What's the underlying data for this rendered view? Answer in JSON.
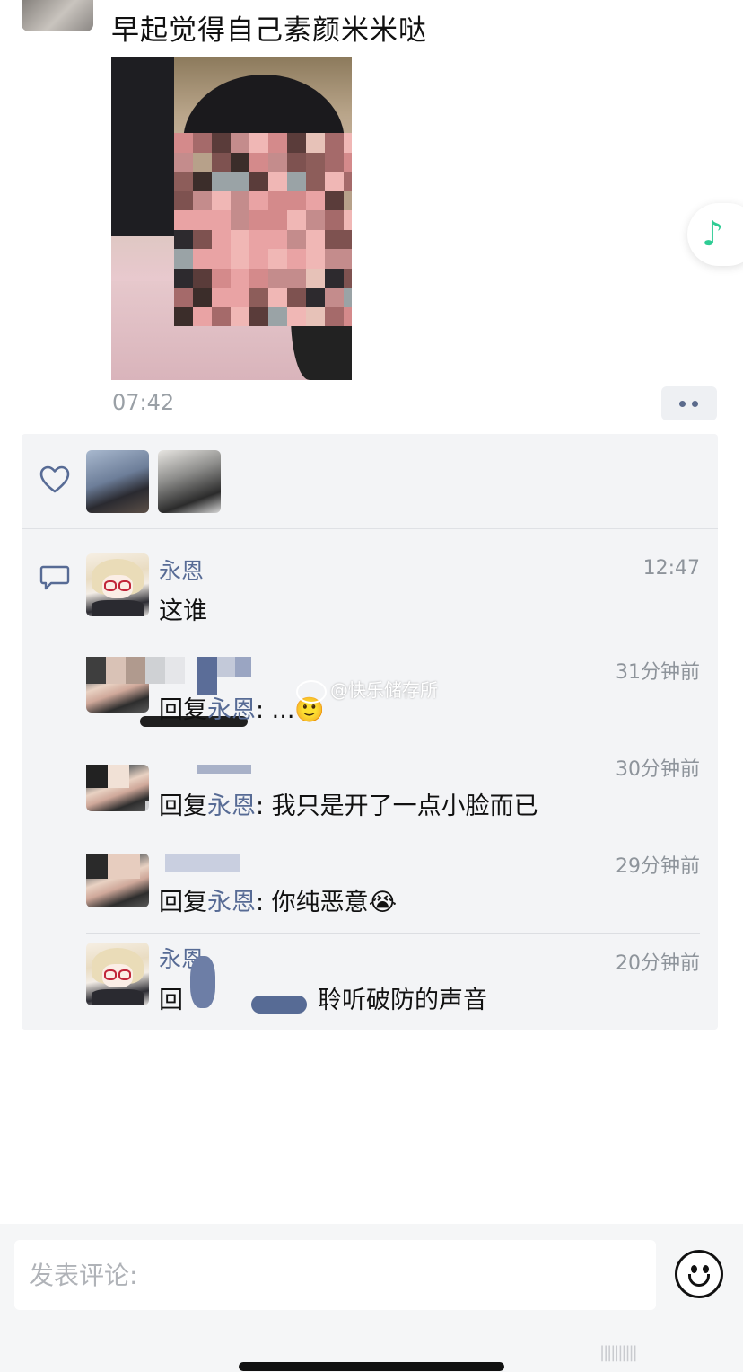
{
  "post": {
    "text": "早起觉得自己素颜米米哒",
    "time": "07:42"
  },
  "icons": {
    "heart": "heart-icon",
    "comment": "comment-bubble-icon",
    "music": "music-note-icon",
    "emoji": "smile-face-icon",
    "more": "more-dots-icon"
  },
  "colors": {
    "link_blue": "#576b95",
    "panel_bg": "#f3f4f6",
    "music_green": "#2ecc94"
  },
  "comments": [
    {
      "name": "永恩",
      "time": "12:47",
      "text": "这谁"
    },
    {
      "name": "",
      "time": "31分钟前",
      "reply_prefix": "回复",
      "reply_to": "永恩",
      "text": ": ...🙂"
    },
    {
      "name": "",
      "time": "30分钟前",
      "reply_prefix": "回复",
      "reply_to": "永恩",
      "text": ": 我只是开了一点小脸而已"
    },
    {
      "name": "",
      "time": "29分钟前",
      "reply_prefix": "回复",
      "reply_to": "永恩",
      "text": ": 你纯恶意😭"
    },
    {
      "name": "永恩",
      "time": "20分钟前",
      "reply_prefix": "回",
      "text": "聆听破防的声音"
    }
  ],
  "watermark": "@快乐储存所",
  "input": {
    "placeholder": "发表评论:"
  },
  "corner_mark": "||||||||||"
}
